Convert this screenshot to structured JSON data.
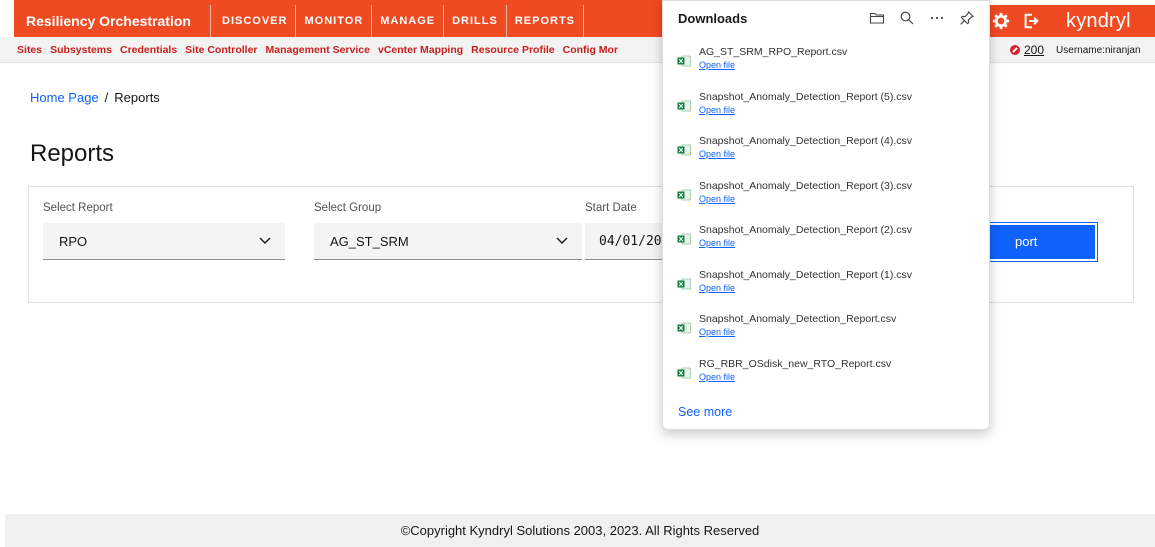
{
  "window": {
    "title": "Reports"
  },
  "topnav": {
    "brand": "Resiliency Orchestration",
    "menu": [
      {
        "label": "DISCOVER"
      },
      {
        "label": "MONITOR"
      },
      {
        "label": "MANAGE"
      },
      {
        "label": "DRILLS"
      },
      {
        "label": "REPORTS"
      }
    ],
    "logo": "kyndryl",
    "icons": [
      "gear-icon",
      "logout-icon"
    ]
  },
  "subnav": {
    "items": [
      {
        "label": "Sites"
      },
      {
        "label": "Subsystems"
      },
      {
        "label": "Credentials"
      },
      {
        "label": "Site Controller"
      },
      {
        "label": "Management Service"
      },
      {
        "label": "vCenter Mapping"
      },
      {
        "label": "Resource Profile"
      },
      {
        "label": "Config Mor"
      }
    ],
    "alert_count": "200",
    "username": "Username:niranjan"
  },
  "breadcrumb": {
    "home": "Home Page",
    "separator": "/",
    "current": "Reports"
  },
  "page": {
    "title": "Reports"
  },
  "form": {
    "report_label": "Select Report",
    "report_value": "RPO",
    "group_label": "Select Group",
    "group_value": "AG_ST_SRM",
    "start_label": "Start Date",
    "start_value": "04/01/20",
    "button_label": "port"
  },
  "downloads": {
    "title": "Downloads",
    "tools": [
      "folder-icon",
      "search-icon",
      "more-icon",
      "pin-icon"
    ],
    "items": [
      {
        "name": "AG_ST_SRM_RPO_Report.csv",
        "action": "Open file"
      },
      {
        "name": "Snapshot_Anomaly_Detection_Report (5).csv",
        "action": "Open file"
      },
      {
        "name": "Snapshot_Anomaly_Detection_Report (4).csv",
        "action": "Open file"
      },
      {
        "name": "Snapshot_Anomaly_Detection_Report (3).csv",
        "action": "Open file"
      },
      {
        "name": "Snapshot_Anomaly_Detection_Report (2).csv",
        "action": "Open file"
      },
      {
        "name": "Snapshot_Anomaly_Detection_Report (1).csv",
        "action": "Open file"
      },
      {
        "name": "Snapshot_Anomaly_Detection_Report.csv",
        "action": "Open file"
      },
      {
        "name": "RG_RBR_OSdisk_new_RTO_Report.csv",
        "action": "Open file"
      }
    ],
    "see_more": "See more"
  },
  "footer": {
    "text": "©Copyright Kyndryl Solutions 2003, 2023. All Rights Reserved"
  },
  "colors": {
    "brand": "#f04a23",
    "link": "#0f62fe",
    "subnav_text": "#c81e1e",
    "alert": "#da1e28"
  }
}
